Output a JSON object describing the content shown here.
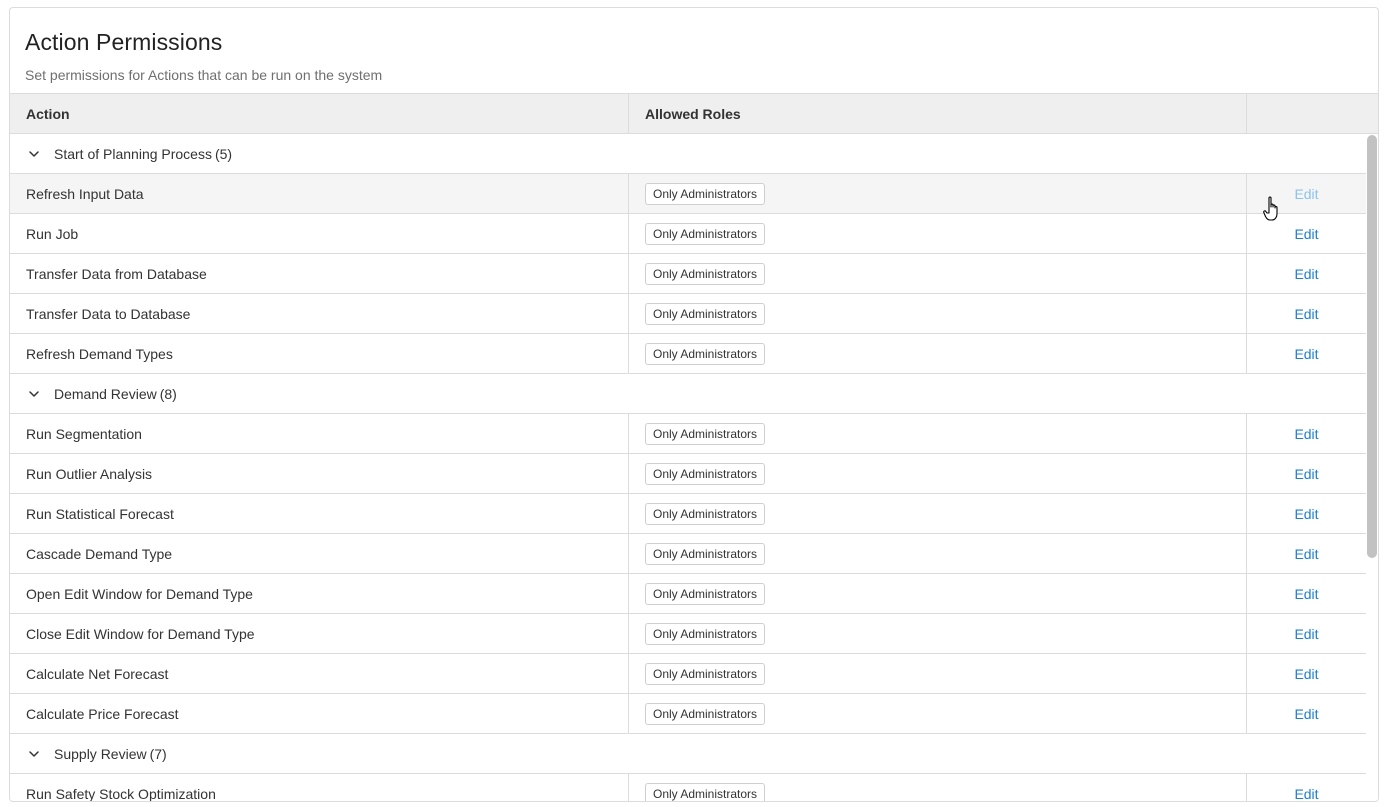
{
  "header": {
    "title": "Action Permissions",
    "subtitle": "Set permissions for Actions that can be run on the system"
  },
  "table": {
    "columns": {
      "action": "Action",
      "roles": "Allowed Roles",
      "edit": ""
    },
    "edit_label": "Edit",
    "groups": [
      {
        "name": "Start of Planning Process",
        "count": "(5)",
        "rows": [
          {
            "action": "Refresh Input Data",
            "role": "Only Administrators"
          },
          {
            "action": "Run Job",
            "role": "Only Administrators"
          },
          {
            "action": "Transfer Data from Database",
            "role": "Only Administrators"
          },
          {
            "action": "Transfer Data to Database",
            "role": "Only Administrators"
          },
          {
            "action": "Refresh Demand Types",
            "role": "Only Administrators"
          }
        ]
      },
      {
        "name": "Demand Review",
        "count": "(8)",
        "rows": [
          {
            "action": "Run Segmentation",
            "role": "Only Administrators"
          },
          {
            "action": "Run Outlier Analysis",
            "role": "Only Administrators"
          },
          {
            "action": "Run Statistical Forecast",
            "role": "Only Administrators"
          },
          {
            "action": "Cascade Demand Type",
            "role": "Only Administrators"
          },
          {
            "action": "Open Edit Window for Demand Type",
            "role": "Only Administrators"
          },
          {
            "action": "Close Edit Window for Demand Type",
            "role": "Only Administrators"
          },
          {
            "action": "Calculate Net Forecast",
            "role": "Only Administrators"
          },
          {
            "action": "Calculate Price Forecast",
            "role": "Only Administrators"
          }
        ]
      },
      {
        "name": "Supply Review",
        "count": "(7)",
        "rows": [
          {
            "action": "Run Safety Stock Optimization",
            "role": "Only Administrators"
          }
        ]
      }
    ]
  },
  "icons": {
    "group_toggle": "chevron-down-icon",
    "cursor": "hand-pointer-icon"
  },
  "colors": {
    "link": "#1f7fcf",
    "header_bg": "#efefef",
    "border": "#dcdcdc"
  }
}
